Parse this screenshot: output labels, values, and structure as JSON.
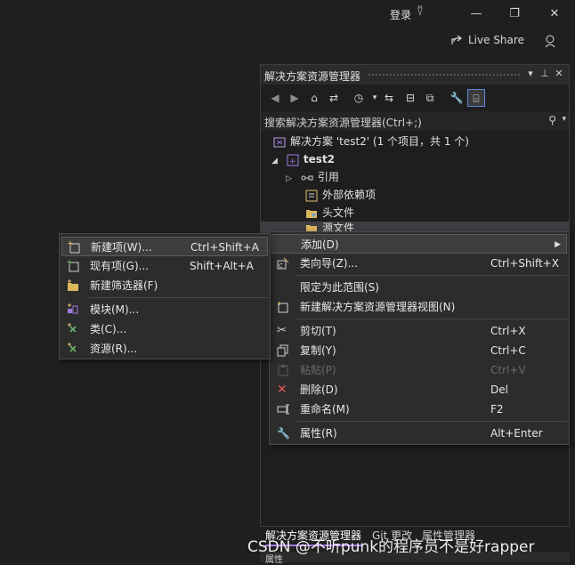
{
  "titlebar": {
    "login": "登录",
    "live_share": "Live Share"
  },
  "solution_explorer": {
    "title": "解决方案资源管理器",
    "search_placeholder": "搜索解决方案资源管理器(Ctrl+;)",
    "tree": [
      {
        "label": "解决方案 'test2' (1 个项目，共 1 个)",
        "icon": "solution-icon"
      },
      {
        "label": "test2",
        "icon": "project-icon"
      },
      {
        "label": "引用",
        "icon": "reference-icon"
      },
      {
        "label": "外部依赖项",
        "icon": "dependency-icon"
      },
      {
        "label": "头文件",
        "icon": "filter-folder-icon"
      },
      {
        "label": "源文件",
        "icon": "filter-folder-icon"
      }
    ]
  },
  "context_menu": {
    "items": [
      {
        "label": "添加(D)",
        "shortcut": ""
      },
      {
        "label": "类向导(Z)...",
        "shortcut": "Ctrl+Shift+X"
      },
      {
        "label": "限定为此范围(S)",
        "shortcut": ""
      },
      {
        "label": "新建解决方案资源管理器视图(N)",
        "shortcut": ""
      },
      {
        "label": "剪切(T)",
        "shortcut": "Ctrl+X"
      },
      {
        "label": "复制(Y)",
        "shortcut": "Ctrl+C"
      },
      {
        "label": "粘贴(P)",
        "shortcut": "Ctrl+V"
      },
      {
        "label": "删除(D)",
        "shortcut": "Del"
      },
      {
        "label": "重命名(M)",
        "shortcut": "F2"
      },
      {
        "label": "属性(R)",
        "shortcut": "Alt+Enter"
      }
    ]
  },
  "add_submenu": {
    "items": [
      {
        "label": "新建项(W)...",
        "shortcut": "Ctrl+Shift+A"
      },
      {
        "label": "现有项(G)...",
        "shortcut": "Shift+Alt+A"
      },
      {
        "label": "新建筛选器(F)",
        "shortcut": ""
      },
      {
        "label": "模块(M)...",
        "shortcut": ""
      },
      {
        "label": "类(C)...",
        "shortcut": ""
      },
      {
        "label": "资源(R)...",
        "shortcut": ""
      }
    ]
  },
  "bottom_tabs": [
    "解决方案资源管理器",
    "Git 更改",
    "属性管理器"
  ],
  "properties_panel_title": "属性",
  "watermark": "CSDN @不听punk的程序员不是好rapper",
  "colors": {
    "background": "#1f1f1f",
    "menu_bg": "#2c2c2c",
    "accent": "#a27ae0",
    "delete_icon": "#e05555"
  }
}
